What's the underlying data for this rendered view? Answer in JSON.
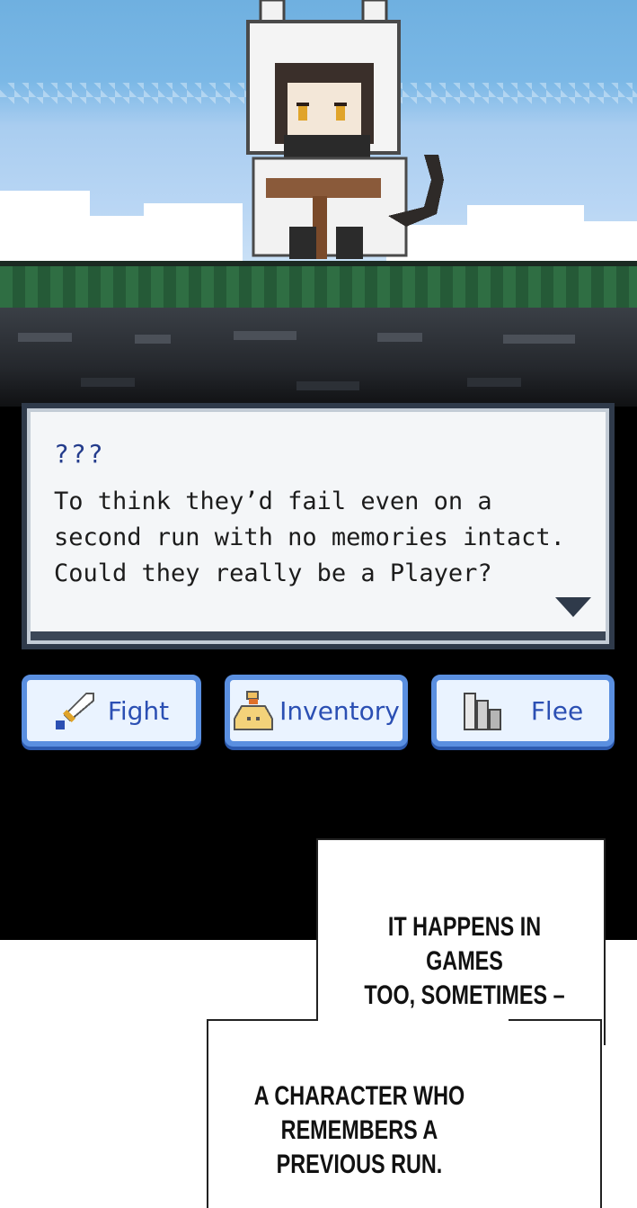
{
  "dialog": {
    "speaker": "???",
    "lines": [
      "To think they’d fail even on a",
      "second run with no memories intact.",
      "Could they really be a Player?"
    ]
  },
  "actions": [
    {
      "label": "Fight",
      "icon": "sword-icon"
    },
    {
      "label": "Inventory",
      "icon": "bag-icon"
    },
    {
      "label": "Flee",
      "icon": "bars-icon"
    }
  ],
  "captions": [
    {
      "lines": [
        "IT HAPPENS IN GAMES",
        "TOO, SOMETIMES –"
      ]
    },
    {
      "lines": [
        "A CHARACTER WHO",
        "REMEMBERS A",
        "PREVIOUS RUN."
      ]
    }
  ],
  "colors": {
    "sky": "#7bb8e6",
    "grass": "#2f6e43",
    "dialog_border": "#2f3a4a",
    "button_border": "#5a8fe0",
    "button_text": "#2b4fb3"
  }
}
